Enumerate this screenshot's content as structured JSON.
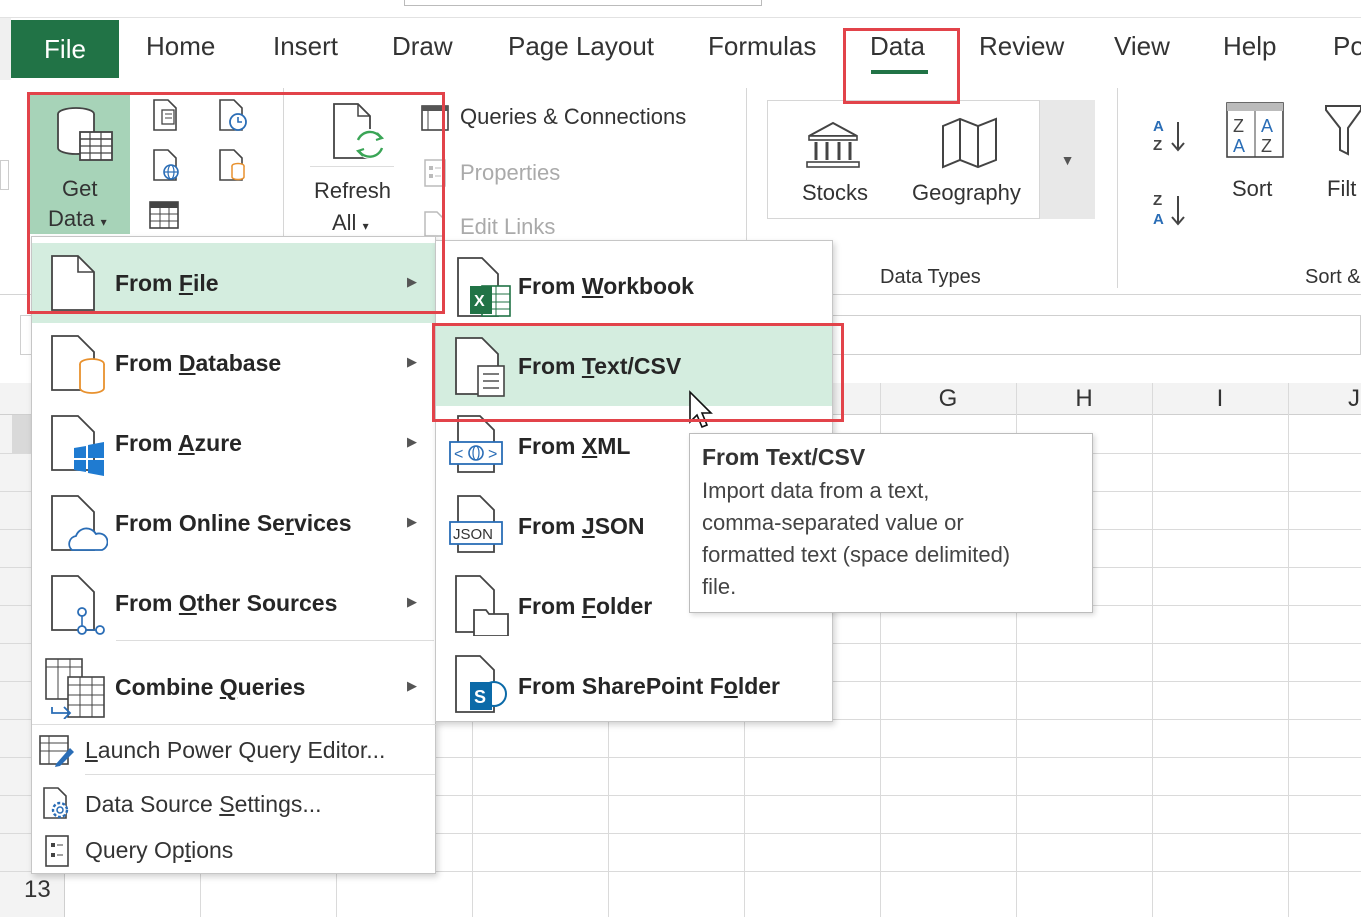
{
  "ribbon": {
    "tabs": {
      "file": "File",
      "home": "Home",
      "insert": "Insert",
      "draw": "Draw",
      "page_layout": "Page Layout",
      "formulas": "Formulas",
      "data": "Data",
      "review": "Review",
      "view": "View",
      "help": "Help",
      "partial": "Po"
    },
    "get_data": {
      "line1": "Get",
      "line2": "Data"
    },
    "refresh": {
      "line1": "Refresh",
      "line2": "All"
    },
    "queries_connections": "Queries & Connections",
    "properties": "Properties",
    "edit_links": "Edit Links",
    "data_types": {
      "stocks": "Stocks",
      "geography": "Geography",
      "group_label": "Data Types"
    },
    "sort": {
      "label": "Sort",
      "filter_partial": "Filt",
      "group_label": "Sort &"
    }
  },
  "grid": {
    "columns": [
      "G",
      "H",
      "I",
      "J"
    ],
    "row_label": "13"
  },
  "get_data_menu": {
    "items": [
      {
        "pre": "From ",
        "u": "F",
        "post": "ile"
      },
      {
        "pre": "From ",
        "u": "D",
        "post": "atabase"
      },
      {
        "pre": "From ",
        "u": "A",
        "post": "zure"
      },
      {
        "pre": "From Online Se",
        "u": "r",
        "post": "vices"
      },
      {
        "pre": "From ",
        "u": "O",
        "post": "ther Sources"
      },
      {
        "pre": "Combine ",
        "u": "Q",
        "post": "ueries"
      }
    ],
    "launch_pq": {
      "u": "L",
      "post": "aunch Power Query Editor..."
    },
    "data_source": {
      "pre": "Data Source ",
      "u": "S",
      "post": "ettings..."
    },
    "query_options": {
      "pre": "Query Op",
      "u": "t",
      "post": "ions"
    }
  },
  "from_file_menu": {
    "items": [
      {
        "pre": "From ",
        "u": "W",
        "post": "orkbook"
      },
      {
        "pre": "From ",
        "u": "T",
        "post": "ext/CSV"
      },
      {
        "pre": "From ",
        "u": "X",
        "post": "ML"
      },
      {
        "pre": "From ",
        "u": "J",
        "post": "SON"
      },
      {
        "pre": "From ",
        "u": "F",
        "post": "older"
      },
      {
        "pre": "From SharePoint F",
        "u": "o",
        "post": "lder"
      }
    ]
  },
  "tooltip": {
    "title": "From Text/CSV",
    "line1": "Import data from a text,",
    "line2": "comma-separated value or",
    "line3": "formatted text (space delimited)",
    "line4": "file."
  },
  "colors": {
    "accent": "#217346",
    "highlight": "#d4eddf",
    "callout": "#e2434a"
  },
  "icons": [
    "document-icon",
    "database-icon",
    "azure-icon",
    "cloud-icon",
    "other-sources-icon",
    "combine-icon",
    "excel-icon",
    "text-file-icon",
    "xml-icon",
    "json-icon",
    "folder-icon",
    "sharepoint-icon",
    "refresh-icon",
    "stocks-icon",
    "geography-icon",
    "sort-az-icon",
    "sort-za-icon",
    "filter-icon"
  ]
}
